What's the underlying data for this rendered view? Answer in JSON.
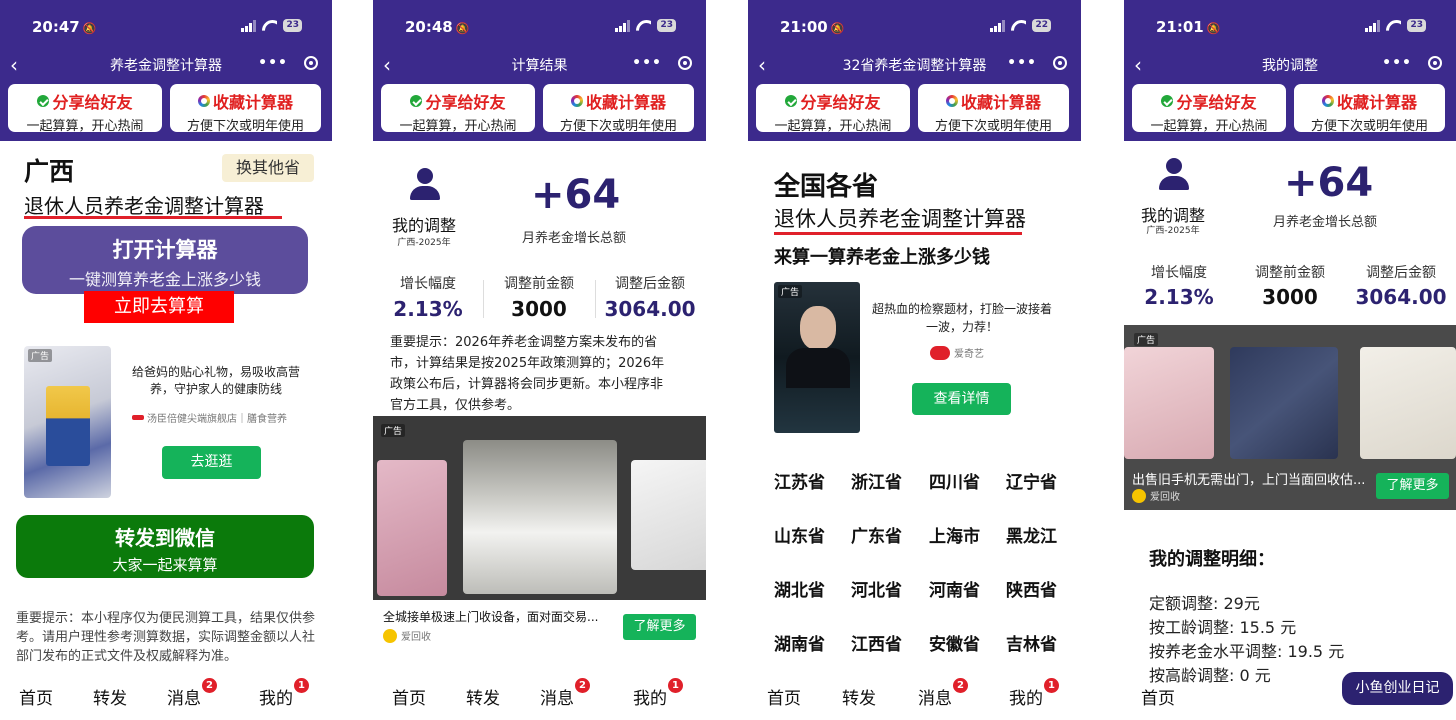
{
  "common": {
    "share": {
      "title": "分享给好友",
      "sub": "一起算算，开心热闹"
    },
    "collect": {
      "title": "收藏计算器",
      "sub": "方便下次或明年使用"
    },
    "ad_tag": "广告",
    "tabs": [
      {
        "label": "首页"
      },
      {
        "label": "转发"
      },
      {
        "label": "消息",
        "badge": "2"
      },
      {
        "label": "我的",
        "badge": "1"
      }
    ]
  },
  "screens": [
    {
      "time": "20:47",
      "battery": "23",
      "nav_title": "养老金调整计算器",
      "province": "广西",
      "switch_label": "换其他省",
      "calc_title": "退休人员养老金调整计算器",
      "open_btn": {
        "title": "打开计算器",
        "sub": "一键测算养老金上涨多少钱"
      },
      "go_btn": "立即去算算",
      "ad": {
        "text": "给爸妈的贴心礼物，易吸收高营养，守护家人的健康防线",
        "brand": "汤臣倍健尖端旗舰店｜膳食营养",
        "button": "去逛逛"
      },
      "forward_btn": {
        "title": "转发到微信",
        "sub": "大家一起来算算"
      },
      "disclaimer": "重要提示：本小程序仅为便民测算工具，结果仅供参考。请用户理性参考测算数据，实际调整金额以人社部门发布的正式文件及权威解释为准。"
    },
    {
      "time": "20:48",
      "battery": "23",
      "nav_title": "计算结果",
      "my_label": "我的调整",
      "my_sub": "广西-2025年",
      "big_number": "+64",
      "big_label": "月养老金增长总额",
      "stats": [
        {
          "label": "增长幅度",
          "value": "2.13%"
        },
        {
          "label": "调整前金额",
          "value": "3000"
        },
        {
          "label": "调整后金额",
          "value": "3064.00"
        }
      ],
      "notice": "重要提示：2026年养老金调整方案未发布的省市，计算结果是按2025年政策测算的；2026年政策公布后，计算器将会同步更新。本小程序非官方工具，仅供参考。",
      "ad": {
        "caption": "全城接单极速上门收设备，面对面交易...",
        "brand": "爱回收",
        "button": "了解更多"
      }
    },
    {
      "time": "21:00",
      "battery": "22",
      "nav_title": "32省养老金调整计算器",
      "heading": "全国各省",
      "subheading": "退休人员养老金调整计算器",
      "tagline": "来算一算养老金上涨多少钱",
      "ad": {
        "text": "超热血的检察题材，打脸一波接着一波，力荐！",
        "brand": "爱奇艺",
        "button": "查看详情"
      },
      "provinces": [
        "江苏省",
        "浙江省",
        "四川省",
        "辽宁省",
        "山东省",
        "广东省",
        "上海市",
        "黑龙江",
        "湖北省",
        "河北省",
        "河南省",
        "陕西省",
        "湖南省",
        "江西省",
        "安徽省",
        "吉林省"
      ]
    },
    {
      "time": "21:01",
      "battery": "23",
      "nav_title": "我的调整",
      "my_label": "我的调整",
      "my_sub": "广西-2025年",
      "big_number": "+64",
      "big_label": "月养老金增长总额",
      "stats": [
        {
          "label": "增长幅度",
          "value": "2.13%"
        },
        {
          "label": "调整前金额",
          "value": "3000"
        },
        {
          "label": "调整后金额",
          "value": "3064.00"
        }
      ],
      "ad": {
        "caption": "出售旧手机无需出门，上门当面回收估...",
        "brand": "爱回收",
        "button": "了解更多"
      },
      "detail_title": "我的调整明细：",
      "details": [
        "定额调整: 29元",
        "按工龄调整: 15.5 元",
        "按养老金水平调整: 19.5 元",
        "按高龄调整: 0 元"
      ],
      "watermark": "小鱼创业日记"
    }
  ],
  "colors": {
    "header": "#3c2a8c",
    "accent_red": "#e0202a",
    "green": "#15b35a",
    "forward_green": "#0b7a0b",
    "number_purple": "#2c2270"
  }
}
